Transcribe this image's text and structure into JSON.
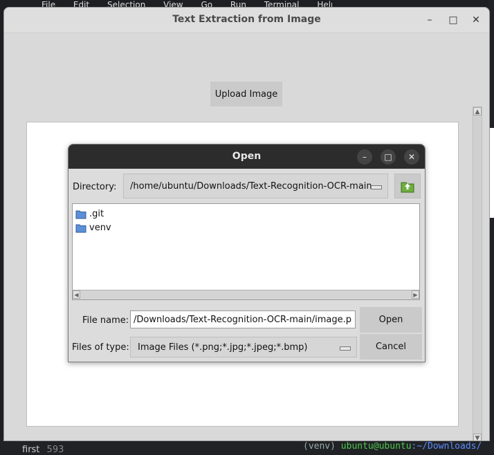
{
  "background": {
    "menu_items": [
      "File",
      "Edit",
      "Selection",
      "View",
      "Go",
      "Run",
      "Terminal",
      "Help"
    ],
    "sidebar_text": "first",
    "sidebar_number": "593",
    "terminal_prefix": "(venv)",
    "terminal_user": "ubuntu@ubuntu",
    "terminal_path": ":~/Downloads/"
  },
  "app": {
    "title": "Text Extraction from Image",
    "upload_button": "Upload Image",
    "controls": {
      "minimize": "–",
      "maximize": "□",
      "close": "✕"
    }
  },
  "dialog": {
    "title": "Open",
    "directory_label": "Directory:",
    "directory_value": "/home/ubuntu/Downloads/Text-Recognition-OCR-main",
    "files": [
      {
        "name": ".git",
        "icon": "folder-icon"
      },
      {
        "name": "venv",
        "icon": "folder-icon"
      }
    ],
    "file_name_label": "File name:",
    "file_name_value": "/Downloads/Text-Recognition-OCR-main/image.png",
    "files_of_type_label": "Files of type:",
    "files_of_type_value": "Image Files (*.png;*.jpg;*.jpeg;*.bmp)",
    "open_button": "Open",
    "cancel_button": "Cancel"
  },
  "colors": {
    "app_bg": "#d9d9d9",
    "dialog_titlebar": "#2c2c2c",
    "folder_icon": "#5b8fd6"
  }
}
